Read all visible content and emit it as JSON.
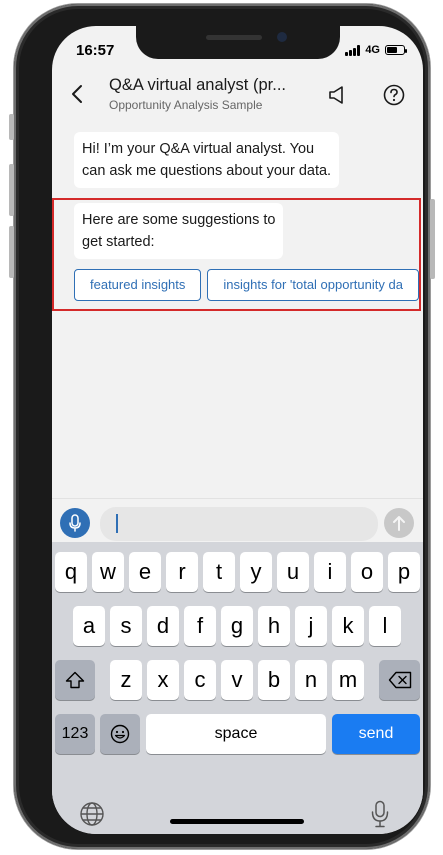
{
  "status": {
    "time": "16:57",
    "network": "4G"
  },
  "header": {
    "title": "Q&A virtual analyst (pr...",
    "subtitle": "Opportunity Analysis Sample"
  },
  "messages": [
    {
      "line1": "Hi! I’m your Q&A virtual analyst. You",
      "line2": "can ask me questions about your data."
    },
    {
      "line1": "Here are some suggestions to",
      "line2": "get started:"
    }
  ],
  "suggestions": [
    {
      "label": "featured insights"
    },
    {
      "label": "insights for 'total opportunity da"
    }
  ],
  "keyboard": {
    "row1": [
      "q",
      "w",
      "e",
      "r",
      "t",
      "y",
      "u",
      "i",
      "o",
      "p"
    ],
    "row2": [
      "a",
      "s",
      "d",
      "f",
      "g",
      "h",
      "j",
      "k",
      "l"
    ],
    "row3": [
      "z",
      "x",
      "c",
      "v",
      "b",
      "n",
      "m"
    ],
    "numbers_label": "123",
    "space_label": "space",
    "send_label": "send"
  },
  "colors": {
    "accent": "#2f6fb5",
    "highlight": "#d42a2a",
    "send_key": "#1a7cf2"
  },
  "icons": [
    "back-chevron-icon",
    "speaker-icon",
    "help-icon",
    "mic-icon",
    "send-arrow-icon",
    "shift-icon",
    "backspace-icon",
    "emoji-icon",
    "globe-icon",
    "dictation-mic-icon"
  ]
}
